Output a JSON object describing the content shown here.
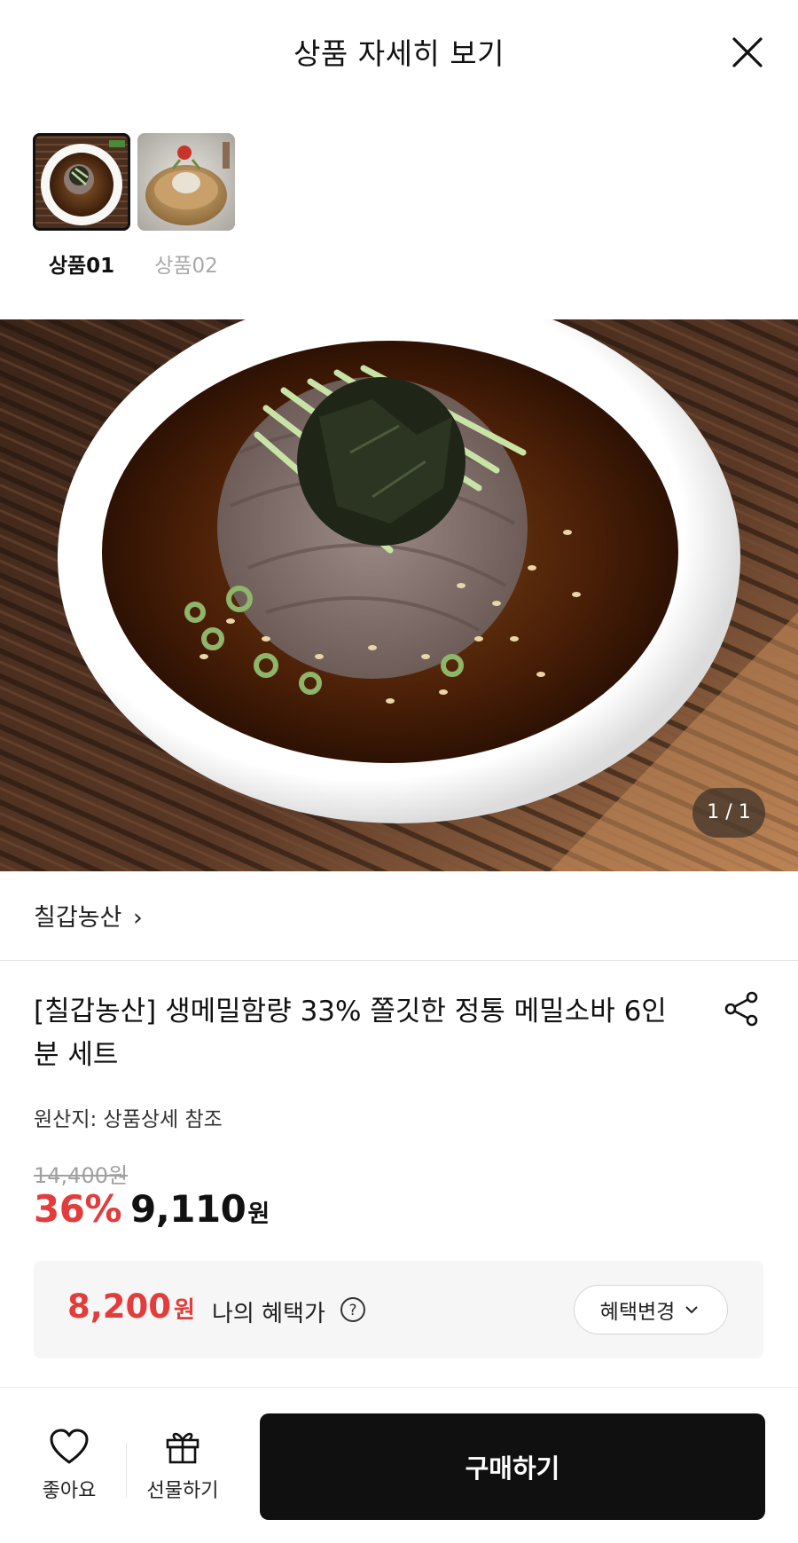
{
  "header": {
    "title": "상품 자세히 보기",
    "close_icon": "close-icon"
  },
  "thumbnails": [
    {
      "label": "상품01",
      "selected": true
    },
    {
      "label": "상품02",
      "selected": false
    }
  ],
  "gallery": {
    "counter": "1 / 1"
  },
  "seller": {
    "name": "칠갑농산",
    "chevron": "›"
  },
  "product": {
    "title": "[칠갑농산] 생메밀함량 33% 쫄깃한 정통 메밀소바 6인분 세트",
    "origin": "원산지: 상품상세 참조",
    "original_price": "14,400원",
    "discount": "36%",
    "price": "9,110",
    "price_unit": "원"
  },
  "benefit": {
    "price": "8,200",
    "price_unit": "원",
    "label": "나의 혜택가",
    "change_label": "혜택변경"
  },
  "bottom_bar": {
    "like_label": "좋아요",
    "gift_label": "선물하기",
    "buy_label": "구매하기"
  },
  "colors": {
    "accent_red": "#e23c3c",
    "buy_button": "#101010"
  }
}
